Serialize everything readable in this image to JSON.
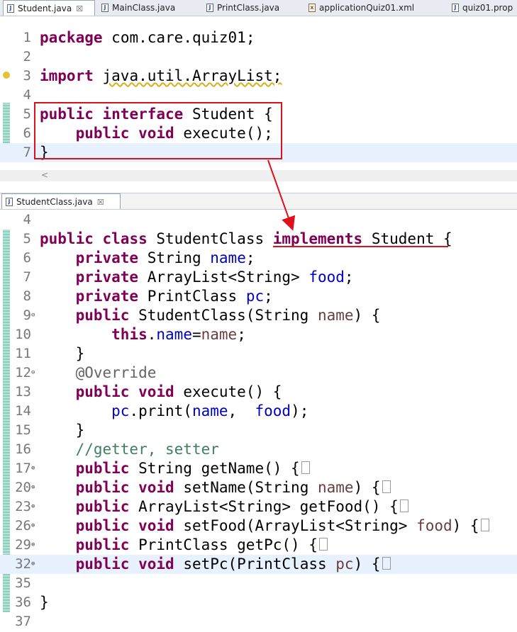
{
  "top_tabs": [
    {
      "label": "Student.java",
      "icon": "java-file-icon",
      "active": true,
      "close": "☒"
    },
    {
      "label": "MainClass.java",
      "icon": "java-file-icon"
    },
    {
      "label": "PrintClass.java",
      "icon": "java-file-icon"
    },
    {
      "label": "applicationQuiz01.xml",
      "icon": "xml-file-icon"
    },
    {
      "label": "quiz01.prop",
      "icon": "java-file-icon"
    }
  ],
  "bottom_tab": {
    "label": "StudentClass.java",
    "icon": "java-file-icon",
    "close": "☒"
  },
  "scroll_arrow": "<",
  "student_java": {
    "l1": {
      "num": "1",
      "code": [
        [
          "kw",
          "package"
        ],
        [
          "",
          "com.care.quiz01;"
        ]
      ]
    },
    "l2": {
      "num": "2",
      "code": []
    },
    "l3": {
      "num": "3",
      "code": [
        [
          "kw",
          "import"
        ],
        [
          "",
          "java.util.ArrayList;"
        ]
      ]
    },
    "l4": {
      "num": "4",
      "code": []
    },
    "l5": {
      "num": "5",
      "code": [
        [
          "kw",
          "public"
        ],
        [
          "kw",
          "interface"
        ],
        [
          "",
          "Student {"
        ]
      ]
    },
    "l6": {
      "num": "6",
      "code": [
        [
          "",
          "    "
        ],
        [
          "kw",
          "public"
        ],
        [
          "kw",
          "void"
        ],
        [
          "",
          "execute();"
        ]
      ]
    },
    "l7": {
      "num": "7",
      "code": [
        [
          "",
          "}"
        ]
      ]
    }
  },
  "student_class_java": [
    {
      "num": "4",
      "code": []
    },
    {
      "num": "5",
      "code": [
        [
          "kw",
          "public"
        ],
        [
          "kw",
          "class"
        ],
        [
          "",
          "StudentClass"
        ],
        [
          "kw",
          "implements"
        ],
        [
          "",
          "Student {"
        ]
      ]
    },
    {
      "num": "6",
      "code": [
        [
          "",
          "    "
        ],
        [
          "kw",
          "private"
        ],
        [
          "",
          "String"
        ],
        [
          "fld",
          "name"
        ],
        [
          "",
          ";"
        ]
      ]
    },
    {
      "num": "7",
      "code": [
        [
          "",
          "    "
        ],
        [
          "kw",
          "private"
        ],
        [
          "",
          "ArrayList<String>"
        ],
        [
          "fld",
          "food"
        ],
        [
          "",
          ";"
        ]
      ]
    },
    {
      "num": "8",
      "code": [
        [
          "",
          "    "
        ],
        [
          "kw",
          "private"
        ],
        [
          "",
          "PrintClass"
        ],
        [
          "fld",
          "pc"
        ],
        [
          "",
          ";"
        ]
      ]
    },
    {
      "num": "9",
      "fold": "⊖",
      "code": [
        [
          "",
          "    "
        ],
        [
          "kw",
          "public"
        ],
        [
          "",
          "StudentClass(String"
        ],
        [
          "prm",
          "name"
        ],
        [
          "",
          ") {"
        ]
      ]
    },
    {
      "num": "10",
      "code": [
        [
          "",
          "        "
        ],
        [
          "kw",
          "this"
        ],
        [
          "",
          "."
        ],
        [
          "fld",
          "name"
        ],
        [
          "",
          "="
        ],
        [
          "prm",
          "name"
        ],
        [
          "",
          ";"
        ]
      ]
    },
    {
      "num": "11",
      "code": [
        [
          "",
          "    }"
        ]
      ]
    },
    {
      "num": "12",
      "fold": "⊖",
      "code": [
        [
          "",
          "    "
        ],
        [
          "ann",
          "@Override"
        ]
      ]
    },
    {
      "num": "13",
      "code": [
        [
          "",
          "    "
        ],
        [
          "kw",
          "public"
        ],
        [
          "kw",
          "void"
        ],
        [
          "",
          "execute() {"
        ]
      ]
    },
    {
      "num": "14",
      "code": [
        [
          "",
          "        "
        ],
        [
          "fld",
          "pc"
        ],
        [
          "",
          ".print("
        ],
        [
          "fld",
          "name"
        ],
        [
          "",
          ", "
        ],
        [
          "fld",
          "food"
        ],
        [
          "",
          ");"
        ]
      ]
    },
    {
      "num": "15",
      "code": [
        [
          "",
          "    }"
        ]
      ]
    },
    {
      "num": "16",
      "code": [
        [
          "",
          "    "
        ],
        [
          "cmt",
          "//getter, setter"
        ]
      ]
    },
    {
      "num": "17",
      "fold": "⊕",
      "code": [
        [
          "",
          "    "
        ],
        [
          "kw",
          "public"
        ],
        [
          "",
          "String getName() {"
        ]
      ],
      "box": true
    },
    {
      "num": "20",
      "fold": "⊕",
      "code": [
        [
          "",
          "    "
        ],
        [
          "kw",
          "public"
        ],
        [
          "kw",
          "void"
        ],
        [
          "",
          "setName(String"
        ],
        [
          "prm",
          "name"
        ],
        [
          "",
          ") {"
        ]
      ],
      "box": true
    },
    {
      "num": "23",
      "fold": "⊕",
      "code": [
        [
          "",
          "    "
        ],
        [
          "kw",
          "public"
        ],
        [
          "",
          "ArrayList<String> getFood() {"
        ]
      ],
      "box": true
    },
    {
      "num": "26",
      "fold": "⊕",
      "code": [
        [
          "",
          "    "
        ],
        [
          "kw",
          "public"
        ],
        [
          "kw",
          "void"
        ],
        [
          "",
          "setFood(ArrayList<String>"
        ],
        [
          "prm",
          "food"
        ],
        [
          "",
          ") {"
        ]
      ],
      "box": true
    },
    {
      "num": "29",
      "fold": "⊕",
      "code": [
        [
          "",
          "    "
        ],
        [
          "kw",
          "public"
        ],
        [
          "",
          "PrintClass getPc() {"
        ]
      ],
      "box": true
    },
    {
      "num": "32",
      "fold": "⊕",
      "code": [
        [
          "",
          "    "
        ],
        [
          "kw",
          "public"
        ],
        [
          "kw",
          "void"
        ],
        [
          "",
          "setPc(PrintClass"
        ],
        [
          "prm",
          "pc"
        ],
        [
          "",
          ") {"
        ]
      ],
      "box": true,
      "current": true
    },
    {
      "num": "35",
      "code": []
    },
    {
      "num": "36",
      "code": [
        [
          "",
          "}"
        ]
      ]
    },
    {
      "num": "37",
      "code": []
    }
  ],
  "colors": {
    "keyword": "#7f0055",
    "field": "#0000c0",
    "param": "#6a3e3e",
    "comment": "#3f7f5f",
    "annotation": "#646464",
    "highlight": "#e0101a"
  }
}
